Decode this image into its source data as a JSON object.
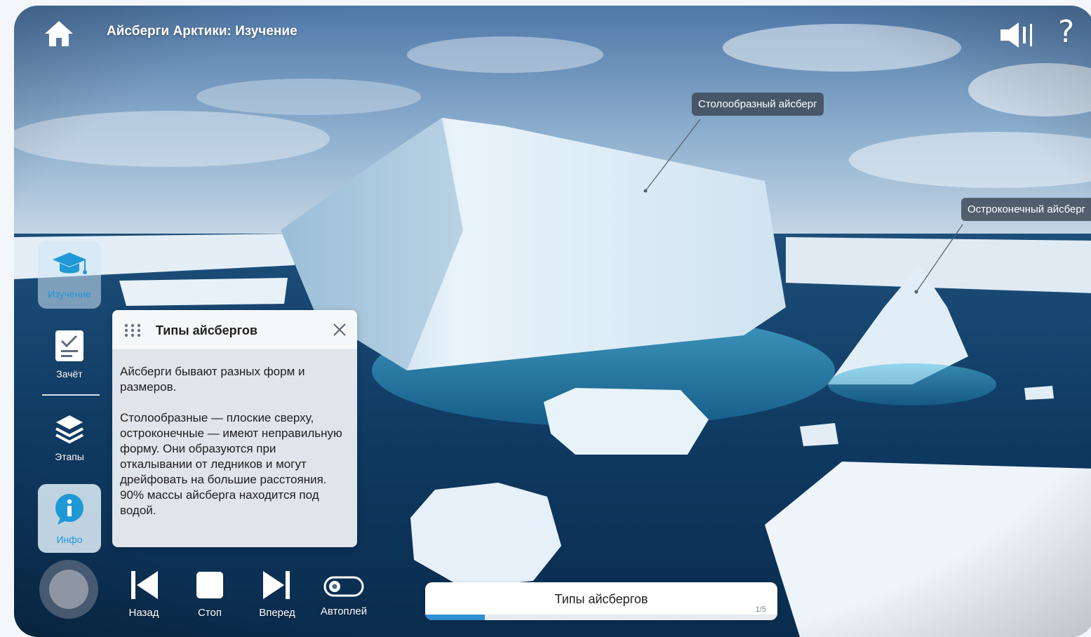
{
  "header": {
    "title": "Айсберги Арктики: Изучение",
    "home_icon": "home-icon",
    "sound_icon": "volume-icon",
    "help_label": "?"
  },
  "callouts": {
    "tabular": "Столообразный айсберг",
    "pinnacle": "Остроконечный айсберг"
  },
  "sidebar": {
    "items": [
      {
        "label": "Изучение",
        "icon": "graduation-cap-icon",
        "state": "active"
      },
      {
        "label": "Зачёт",
        "icon": "checklist-icon"
      },
      {
        "label": "Этапы",
        "icon": "layers-icon"
      },
      {
        "label": "Инфо",
        "icon": "info-icon",
        "state": "selected"
      }
    ]
  },
  "info_panel": {
    "title": "Типы айсбергов",
    "body": "Айсберги бывают разных форм и размеров.\n\nСтолообразные — плоские сверху, остроконечные — имеют неправильную форму. Они образуются при откалывании от ледников и могут дрейфовать на большие расстояния.\n90% массы айсберга находится под водой."
  },
  "controls": {
    "back": "Назад",
    "stop": "Стоп",
    "forward": "Вперед",
    "autoplay": "Автоплей"
  },
  "progress": {
    "label": "Типы айсбергов",
    "count": "1/5",
    "value": 0.17
  },
  "colors": {
    "accent": "#2f8fd3",
    "panel_bg": "#eef0f3",
    "callout_bg": "#3c4655"
  }
}
